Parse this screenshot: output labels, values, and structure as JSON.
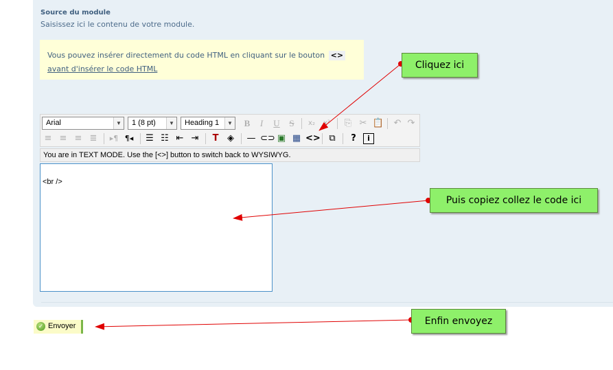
{
  "section": {
    "title": "Source du module",
    "description": "Saisissez ici le contenu de votre module."
  },
  "note": {
    "text_before": "Vous pouvez insérer directement du code HTML en cliquant sur le bouton",
    "code_icon": "<>",
    "link_text": "avant d'insérer le code HTML"
  },
  "toolbar": {
    "font_select": "Arial",
    "size_select": "1 (8 pt)",
    "format_select": "Heading 1",
    "row1_buttons": [
      "B",
      "I",
      "U",
      "S",
      "x₂",
      "x²",
      "copy-icon",
      "cut-icon",
      "paste-icon",
      "undo-icon",
      "redo-icon"
    ],
    "row2_buttons": [
      "align-left-icon",
      "align-center-icon",
      "align-right-icon",
      "justify-icon",
      "ltr-icon",
      "rtl-icon",
      "ordered-list-icon",
      "unordered-list-icon",
      "outdent-icon",
      "indent-icon",
      "text-color-icon",
      "bg-color-icon",
      "hr-icon",
      "link-icon",
      "image-icon",
      "table-icon",
      "html-mode-icon",
      "fullscreen-icon",
      "help-icon",
      "info-icon"
    ]
  },
  "status_text": "You are in TEXT MODE. Use the [<>] button to switch back to WYSIWYG.",
  "editor_content": "<br />",
  "send_button": "Envoyer",
  "callouts": {
    "click_here": "Cliquez ici",
    "paste_here": "Puis copiez collez le code ici",
    "send": "Enfin envoyez"
  },
  "colors": {
    "panel_bg": "#e8f0f6",
    "callout_bg": "#8ef06a",
    "arrow": "#e00000",
    "note_bg": "#ffffd8"
  }
}
